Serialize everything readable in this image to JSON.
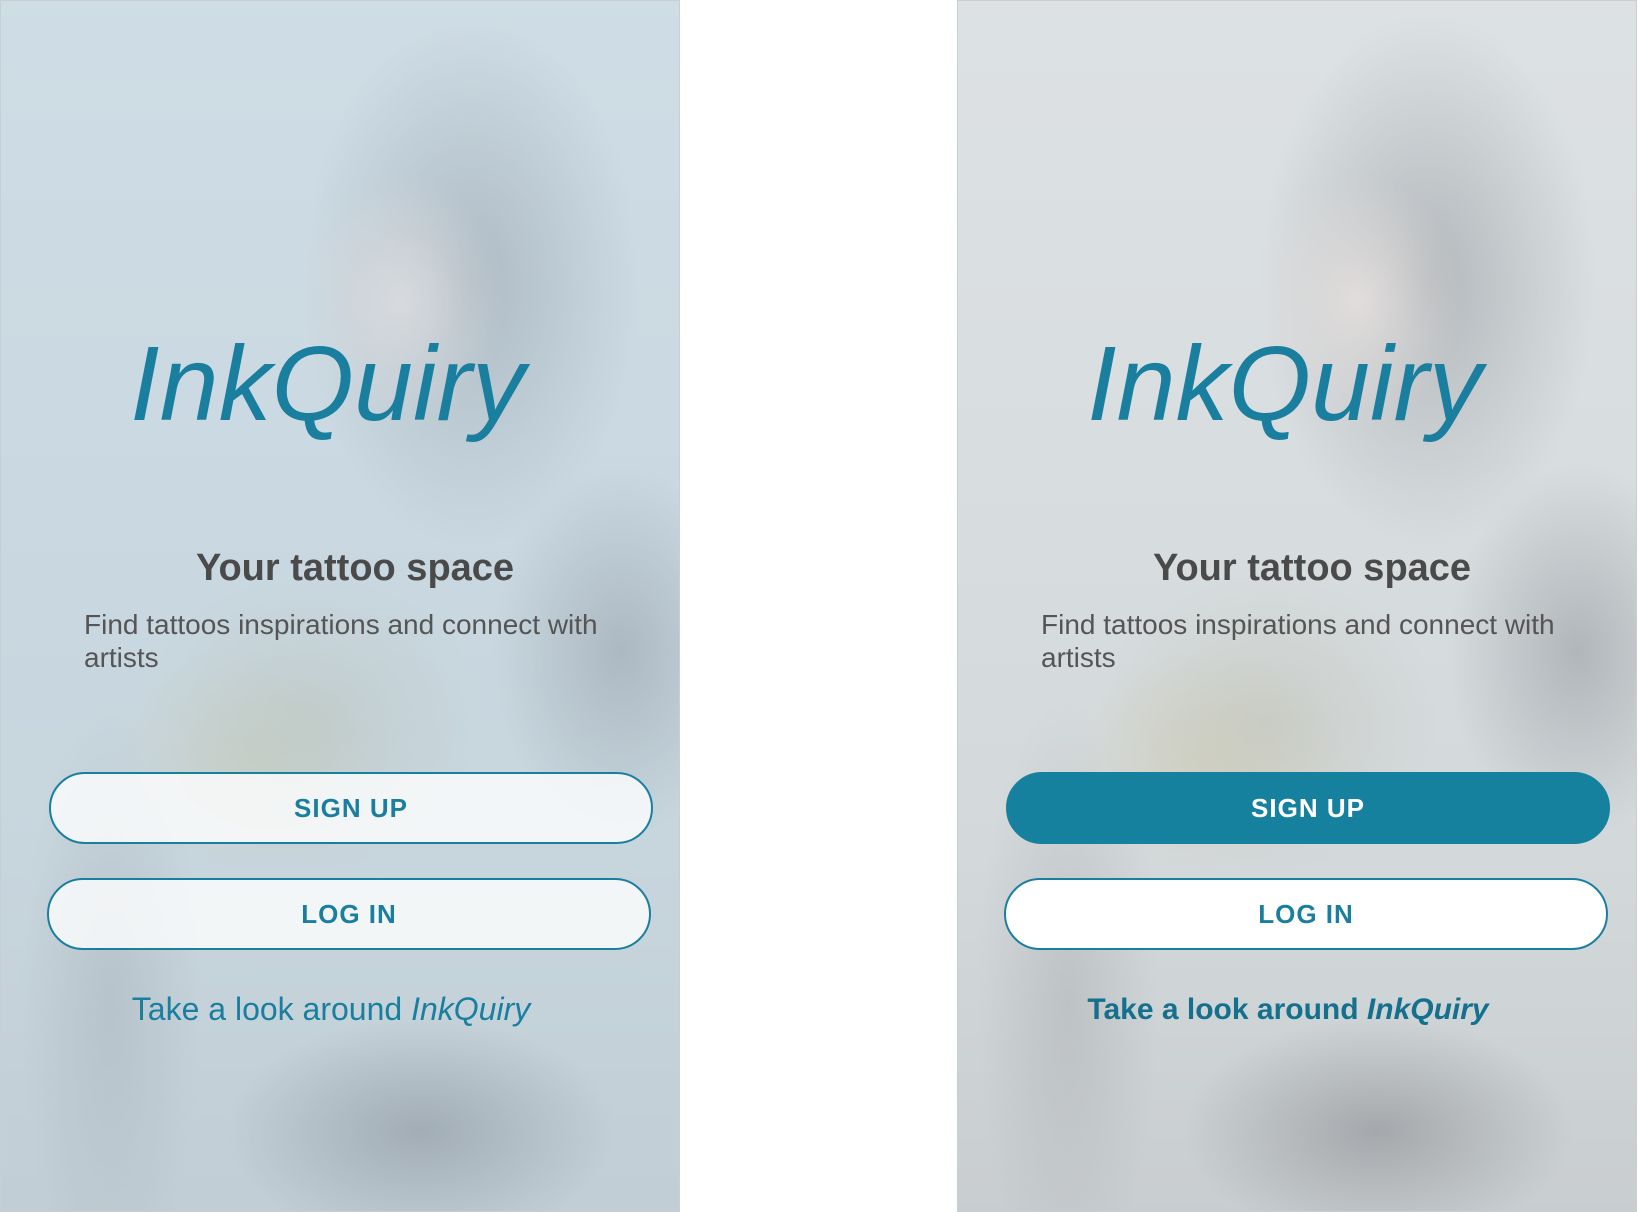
{
  "screens": {
    "default": {
      "logo": "InkQuiry",
      "tagline": "Your tattoo space",
      "subtitle": "Find tattoos inspirations and connect with artists",
      "signup_label": "SIGN UP",
      "login_label": "LOG IN",
      "explore_prefix": "Take a look around ",
      "explore_brand": "InkQuiry"
    },
    "active": {
      "logo": "InkQuiry",
      "tagline": "Your tattoo space",
      "subtitle": "Find tattoos inspirations and connect with artists",
      "signup_label": "SIGN UP",
      "login_label": "LOG IN",
      "explore_prefix": "Take a look around ",
      "explore_brand": "InkQuiry"
    }
  },
  "colors": {
    "brand": "#1a7f9f",
    "primary_button_fill": "#16809f",
    "text_dark": "#4a4a4a",
    "text_muted": "#555555"
  }
}
